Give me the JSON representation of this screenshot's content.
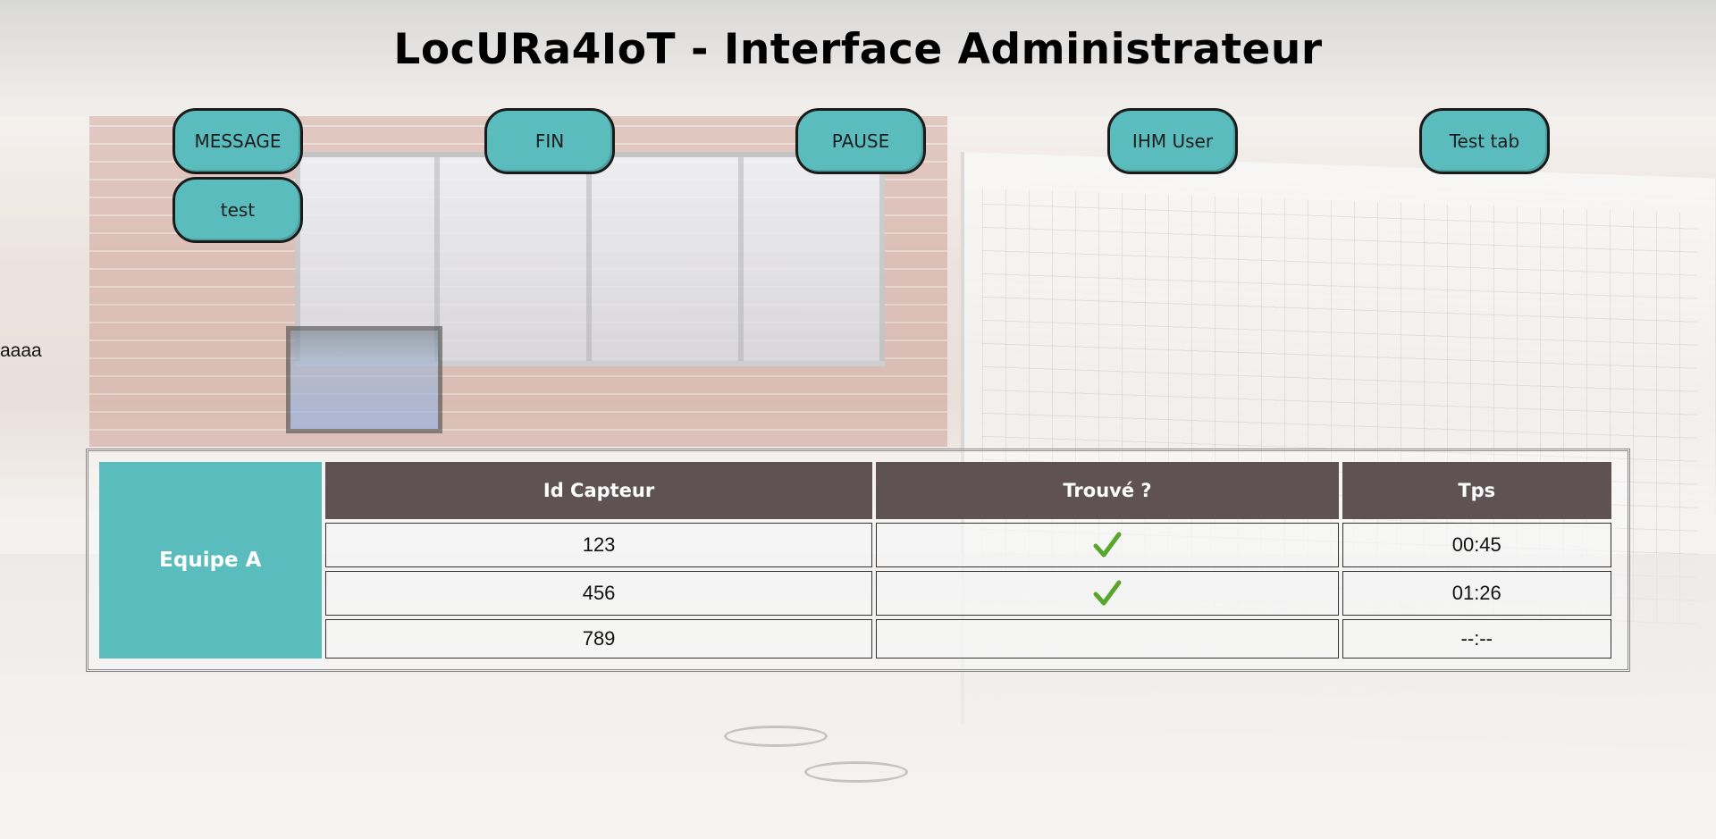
{
  "page": {
    "title": "LocURa4IoT - Interface Administrateur",
    "stray_text": "aaaa"
  },
  "buttons": [
    {
      "label": "MESSAGE"
    },
    {
      "label": "FIN"
    },
    {
      "label": "PAUSE"
    },
    {
      "label": "IHM User"
    },
    {
      "label": "Test tab"
    },
    {
      "label": "test"
    }
  ],
  "table": {
    "team": "Equipe A",
    "headers": [
      "Id Capteur",
      "Trouvé ?",
      "Tps"
    ],
    "rows": [
      {
        "id": "123",
        "found": true,
        "time": "00:45"
      },
      {
        "id": "456",
        "found": true,
        "time": "01:26"
      },
      {
        "id": "789",
        "found": false,
        "time": "--:--"
      }
    ]
  },
  "icons": {
    "found": "check-icon"
  },
  "colors": {
    "button_bg": "#5bbcbd",
    "header_bg": "#5e5255",
    "team_bg": "#5bbcbd",
    "check": "#5aa52c"
  }
}
